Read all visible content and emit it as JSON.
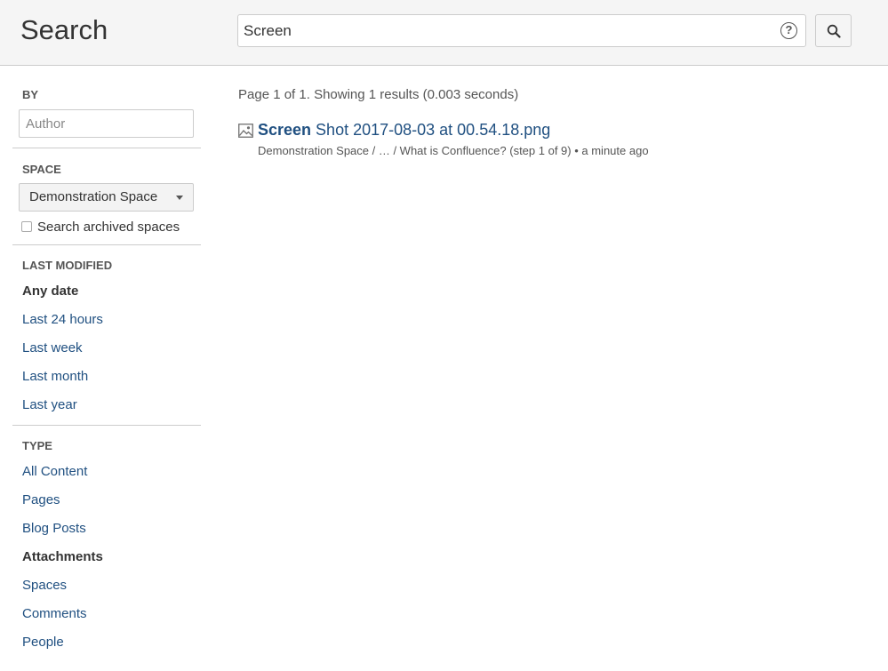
{
  "header": {
    "title": "Search",
    "query": "Screen",
    "help_symbol": "?"
  },
  "sidebar": {
    "by": {
      "heading": "BY",
      "author_placeholder": "Author"
    },
    "space": {
      "heading": "SPACE",
      "selected": "Demonstration Space",
      "archived_label": "Search archived spaces"
    },
    "last_modified": {
      "heading": "LAST MODIFIED",
      "items": [
        {
          "label": "Any date",
          "active": true
        },
        {
          "label": "Last 24 hours",
          "active": false
        },
        {
          "label": "Last week",
          "active": false
        },
        {
          "label": "Last month",
          "active": false
        },
        {
          "label": "Last year",
          "active": false
        }
      ]
    },
    "type": {
      "heading": "TYPE",
      "items": [
        {
          "label": "All Content",
          "active": false
        },
        {
          "label": "Pages",
          "active": false
        },
        {
          "label": "Blog Posts",
          "active": false
        },
        {
          "label": "Attachments",
          "active": true
        },
        {
          "label": "Spaces",
          "active": false
        },
        {
          "label": "Comments",
          "active": false
        },
        {
          "label": "People",
          "active": false
        }
      ]
    }
  },
  "results": {
    "summary": "Page 1 of 1. Showing 1 results (0.003 seconds)",
    "items": [
      {
        "title_highlight": "Screen",
        "title_rest": " Shot 2017-08-03 at 00.54.18.png",
        "meta": "Demonstration Space / … / What is Confluence? (step 1 of 9) • a minute ago"
      }
    ]
  },
  "colors": {
    "link": "#205081",
    "header_bg": "#f5f5f5",
    "border": "#cccccc"
  }
}
